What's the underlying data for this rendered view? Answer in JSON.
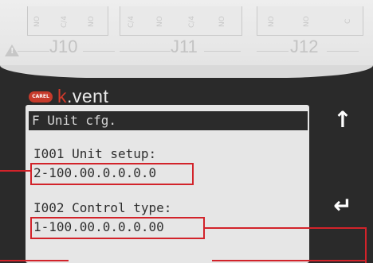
{
  "connectors": [
    {
      "label": "J10",
      "pins": [
        "NO",
        "C/4",
        "NO"
      ]
    },
    {
      "label": "J11",
      "pins": [
        "C/4",
        "NO",
        "C/4",
        "NO"
      ]
    },
    {
      "label": "J12",
      "pins": [
        "NO",
        "NO",
        "C"
      ]
    }
  ],
  "brand": {
    "logo_text": "CAREL",
    "name_prefix": "k",
    "name_rest": ".vent"
  },
  "display": {
    "menu_title": "F Unit cfg.",
    "params": [
      {
        "label": "I001 Unit setup:",
        "value": "2-100.00.0.0.0.0"
      },
      {
        "label": "I002 Control type:",
        "value": "1-100.00.0.0.0.00"
      }
    ]
  },
  "buttons": {
    "up": "↑",
    "enter": "↵"
  },
  "colors": {
    "highlight": "#d2232a",
    "lcd_bg": "#e6e6e6",
    "brand_red": "#d33a2b"
  }
}
